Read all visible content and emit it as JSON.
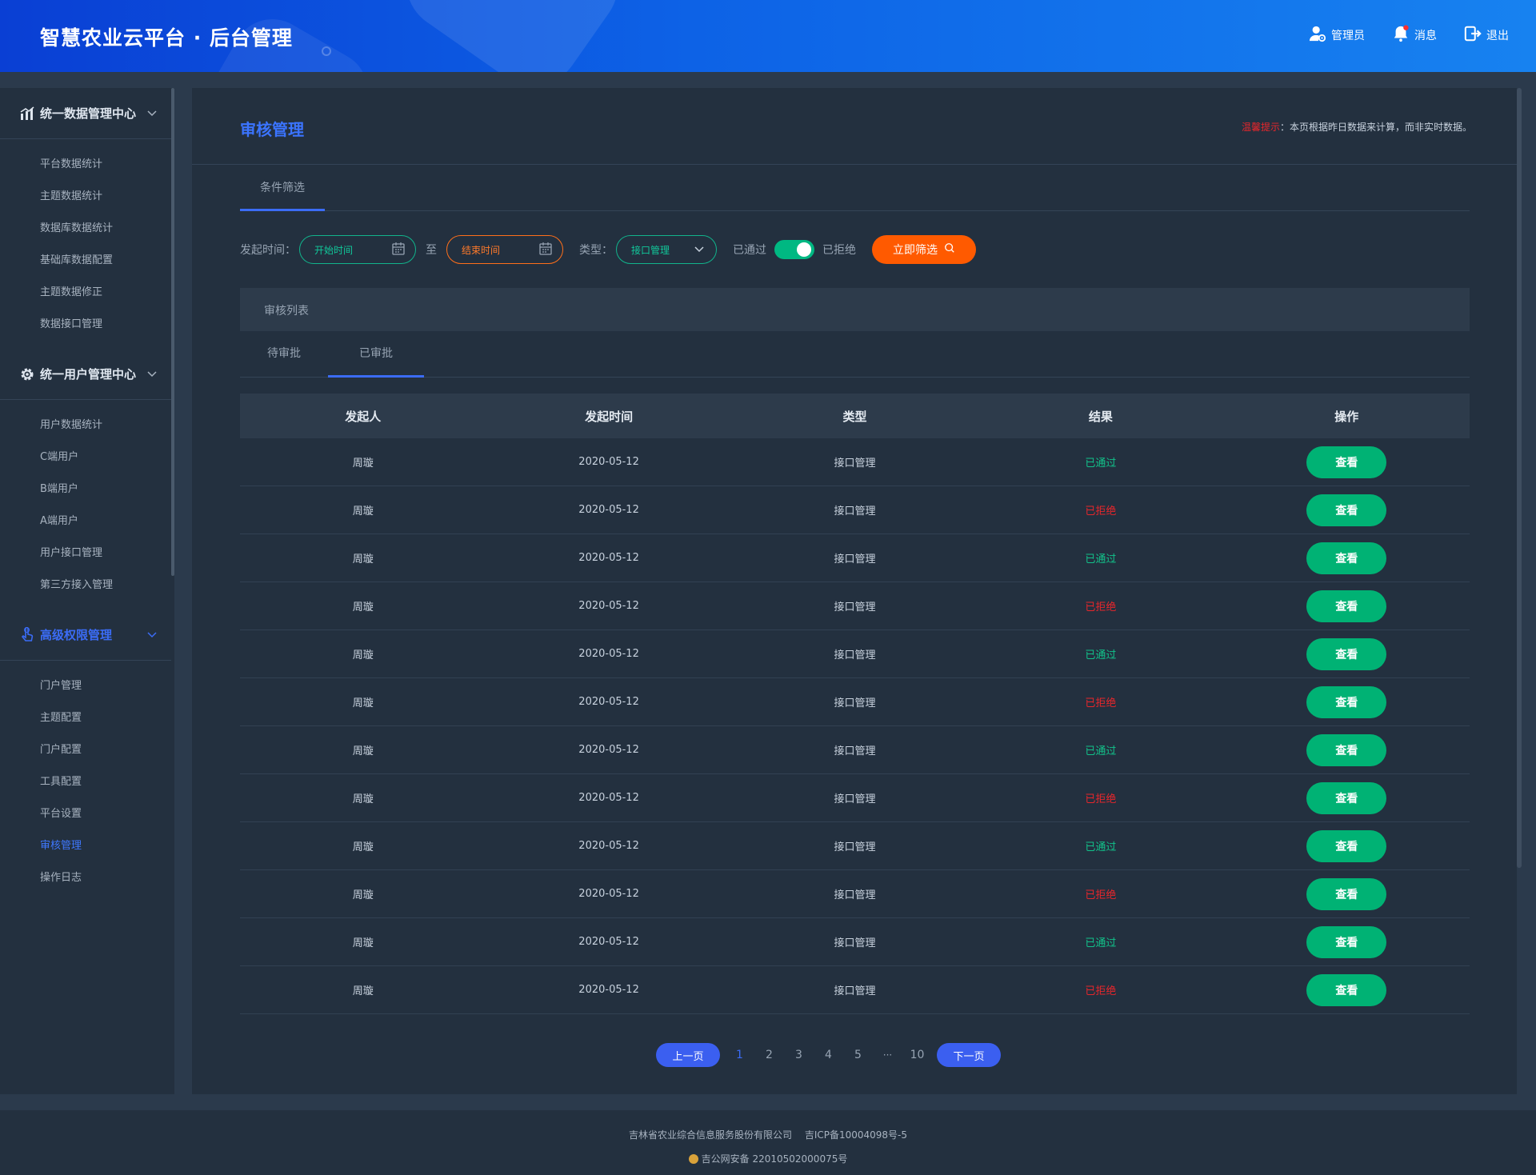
{
  "header": {
    "title": "智慧农业云平台 · 后台管理",
    "admin_label": "管理员",
    "message_label": "消息",
    "logout_label": "退出"
  },
  "sidebar": {
    "groups": [
      {
        "label": "统一数据管理中心",
        "icon": "chart-icon",
        "items": [
          "平台数据统计",
          "主题数据统计",
          "数据库数据统计",
          "基础库数据配置",
          "主题数据修正",
          "数据接口管理"
        ]
      },
      {
        "label": "统一用户管理中心",
        "icon": "gear-icon",
        "items": [
          "用户数据统计",
          "C端用户",
          "B端用户",
          "A端用户",
          "用户接口管理",
          "第三方接入管理"
        ]
      },
      {
        "label": "高级权限管理",
        "icon": "hand-pointer-icon",
        "items": [
          "门户管理",
          "主题配置",
          "门户配置",
          "工具配置",
          "平台设置",
          "审核管理",
          "操作日志"
        ]
      }
    ],
    "active_item": "审核管理"
  },
  "page": {
    "title": "审核管理",
    "tip_label": "温馨提示",
    "tip_text": "：本页根据昨日数据来计算，而非实时数据。",
    "filter_tab": "条件筛选"
  },
  "filters": {
    "start_label": "发起时间：",
    "start_placeholder": "开始时间",
    "to_label": "至",
    "end_placeholder": "结束时间",
    "type_label": "类型：",
    "type_value": "接口管理",
    "passed_label": "已通过",
    "rejected_label": "已拒绝",
    "toggle_on": true,
    "button_label": "立即筛选"
  },
  "list": {
    "card_title": "审核列表",
    "tabs": [
      "待审批",
      "已审批"
    ],
    "active_tab": "已审批",
    "columns": [
      "发起人",
      "发起时间",
      "类型",
      "结果",
      "操作"
    ],
    "rows": [
      {
        "initiator": "周璇",
        "time": "2020-05-12",
        "type": "接口管理",
        "result": "已通过",
        "action": "查看"
      },
      {
        "initiator": "周璇",
        "time": "2020-05-12",
        "type": "接口管理",
        "result": "已拒绝",
        "action": "查看"
      },
      {
        "initiator": "周璇",
        "time": "2020-05-12",
        "type": "接口管理",
        "result": "已通过",
        "action": "查看"
      },
      {
        "initiator": "周璇",
        "time": "2020-05-12",
        "type": "接口管理",
        "result": "已拒绝",
        "action": "查看"
      },
      {
        "initiator": "周璇",
        "time": "2020-05-12",
        "type": "接口管理",
        "result": "已通过",
        "action": "查看"
      },
      {
        "initiator": "周璇",
        "time": "2020-05-12",
        "type": "接口管理",
        "result": "已拒绝",
        "action": "查看"
      },
      {
        "initiator": "周璇",
        "time": "2020-05-12",
        "type": "接口管理",
        "result": "已通过",
        "action": "查看"
      },
      {
        "initiator": "周璇",
        "time": "2020-05-12",
        "type": "接口管理",
        "result": "已拒绝",
        "action": "查看"
      },
      {
        "initiator": "周璇",
        "time": "2020-05-12",
        "type": "接口管理",
        "result": "已通过",
        "action": "查看"
      },
      {
        "initiator": "周璇",
        "time": "2020-05-12",
        "type": "接口管理",
        "result": "已拒绝",
        "action": "查看"
      },
      {
        "initiator": "周璇",
        "time": "2020-05-12",
        "type": "接口管理",
        "result": "已通过",
        "action": "查看"
      },
      {
        "initiator": "周璇",
        "time": "2020-05-12",
        "type": "接口管理",
        "result": "已拒绝",
        "action": "查看"
      }
    ]
  },
  "pagination": {
    "prev_label": "上一页",
    "next_label": "下一页",
    "pages": [
      "1",
      "2",
      "3",
      "4",
      "5",
      "···",
      "10"
    ],
    "current": "1"
  },
  "footer": {
    "company": "吉林省农业综合信息服务股份有限公司",
    "icp": "吉ICP备10004098号-5",
    "police": "吉公网安备 22010502000075号"
  },
  "colors": {
    "accent": "#3b6cf6",
    "pass": "#12c28a",
    "reject": "#e8262b",
    "view_button": "#00b274",
    "filter_button": "#ff5a00"
  }
}
